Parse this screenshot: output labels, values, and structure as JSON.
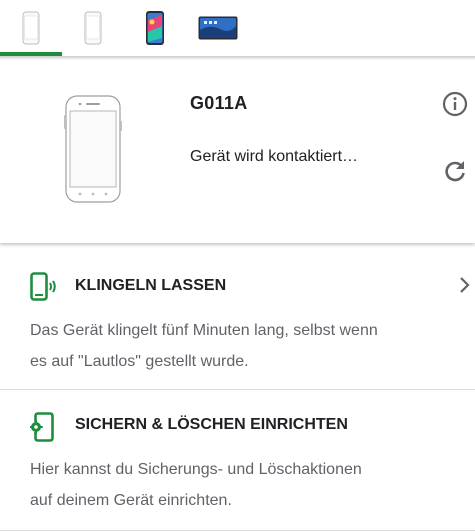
{
  "tabs": [
    {
      "icon": "phone-outline-icon",
      "active": true
    },
    {
      "icon": "phone-outline-icon",
      "active": false
    },
    {
      "icon": "phone-colorful-icon",
      "active": false
    },
    {
      "icon": "tablet-icon",
      "active": false
    }
  ],
  "device": {
    "name": "G011A",
    "status": "Gerät wird kontaktiert…",
    "image_icon": "phone-illustration-icon"
  },
  "actions": {
    "ring": {
      "icon": "phone-ring-icon",
      "title": "KLINGELN LASSEN",
      "desc_line1": "Das Gerät klingelt fünf Minuten lang, selbst wenn",
      "desc_line2": "es auf \"Lautlos\" gestellt wurde."
    },
    "secure": {
      "icon": "phone-gear-icon",
      "title": "SICHERN & LÖSCHEN EINRICHTEN",
      "desc_line1": "Hier kannst du Sicherungs- und Löschaktionen",
      "desc_line2": "auf deinem Gerät einrichten."
    }
  },
  "colors": {
    "accent": "#1e8e3e",
    "text": "#202124",
    "muted": "#5f6368"
  }
}
